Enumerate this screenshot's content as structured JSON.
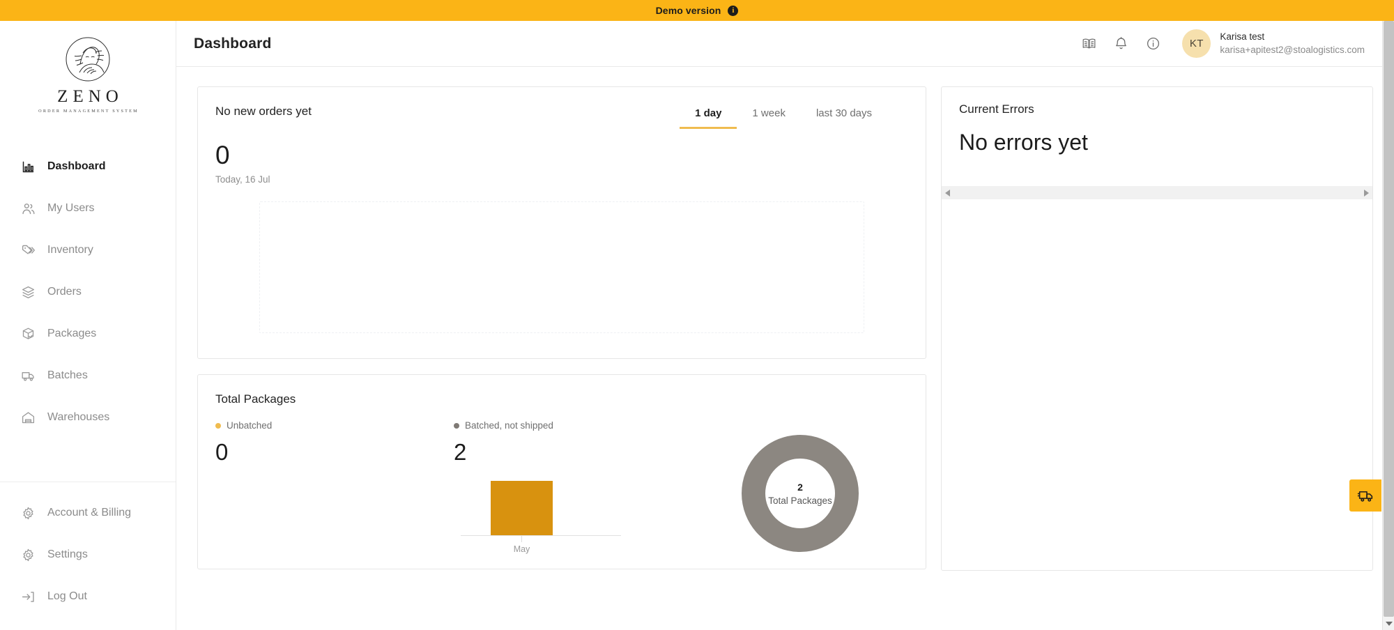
{
  "banner": {
    "label": "Demo version",
    "info_icon": "info-filled-icon",
    "bg_color": "#fbb416"
  },
  "brand": {
    "wordmark": "ZENO",
    "tagline": "ORDER MANAGEMENT SYSTEM",
    "logo_icon": "zeno-philosopher-emblem-icon"
  },
  "sidebar": {
    "items": [
      {
        "label": "Dashboard",
        "icon": "bar-chart-icon",
        "active": true
      },
      {
        "label": "My Users",
        "icon": "users-icon",
        "active": false
      },
      {
        "label": "Inventory",
        "icon": "tags-icon",
        "active": false
      },
      {
        "label": "Orders",
        "icon": "open-box-icon",
        "active": false
      },
      {
        "label": "Packages",
        "icon": "package-check-icon",
        "active": false
      },
      {
        "label": "Batches",
        "icon": "truck-icon",
        "active": false
      },
      {
        "label": "Warehouses",
        "icon": "warehouse-icon",
        "active": false
      }
    ],
    "bottom_items": [
      {
        "label": "Account & Billing",
        "icon": "gear-icon"
      },
      {
        "label": "Settings",
        "icon": "gear-icon"
      },
      {
        "label": "Log Out",
        "icon": "logout-icon"
      }
    ]
  },
  "header": {
    "title": "Dashboard",
    "icons": [
      {
        "name": "book-icon"
      },
      {
        "name": "bell-icon"
      },
      {
        "name": "info-circle-icon"
      }
    ],
    "user": {
      "initials": "KT",
      "name": "Karisa test",
      "email": "karisa+apitest2@stoalogistics.com",
      "avatar_color": "#f6e0ad"
    }
  },
  "orders_card": {
    "title": "No new orders yet",
    "count": "0",
    "date": "Today, 16 Jul",
    "tabs": [
      {
        "label": "1 day",
        "active": true
      },
      {
        "label": "1 week",
        "active": false
      },
      {
        "label": "last 30 days",
        "active": false
      }
    ],
    "accent_color": "#f0bc4f"
  },
  "packages_card": {
    "title": "Total Packages",
    "legend": [
      {
        "label": "Unbatched",
        "value": "0",
        "color": "#f0bc4f"
      },
      {
        "label": "Batched, not shipped",
        "value": "2",
        "color": "#7f7a75"
      }
    ],
    "donut": {
      "center_value": "2",
      "center_label": "Total Packages"
    }
  },
  "errors_card": {
    "title": "Current Errors",
    "empty_message": "No errors yet",
    "scroll_left_icon": "caret-left-icon",
    "scroll_right_icon": "caret-right-icon"
  },
  "floating": {
    "truck_icon": "delivery-truck-icon",
    "color": "#fbb416"
  },
  "scrollbar": {
    "down_arrow_icon": "caret-down-icon"
  },
  "chart_data": [
    {
      "type": "bar",
      "title": "Total Packages",
      "categories": [
        "May"
      ],
      "values": [
        2
      ],
      "series": [
        {
          "name": "Unbatched",
          "values": [
            0
          ],
          "color": "#f0bc4f"
        },
        {
          "name": "Batched, not shipped",
          "values": [
            2
          ],
          "color": "#d8920f"
        }
      ],
      "xlabel": "",
      "ylabel": "",
      "ylim": [
        0,
        2
      ],
      "grid": false,
      "legend_position": "top-left"
    },
    {
      "type": "pie",
      "title": "Total Packages",
      "categories": [
        "Unbatched",
        "Batched, not shipped"
      ],
      "values": [
        0,
        2
      ],
      "colors": [
        "#f0bc4f",
        "#8c8781"
      ],
      "center_value": "2",
      "center_label": "Total Packages",
      "legend_position": "top-left"
    }
  ]
}
